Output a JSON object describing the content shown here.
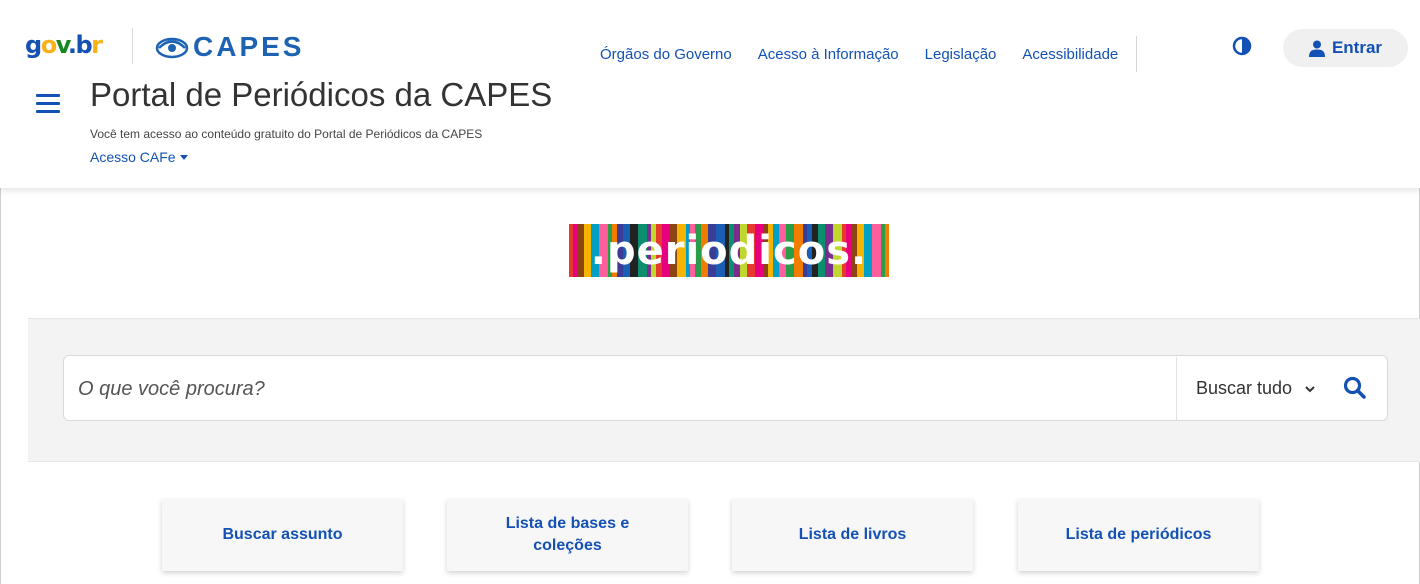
{
  "brand": {
    "govbr": "gov.br",
    "capes": "CAPES"
  },
  "nav": {
    "links": [
      "Órgãos do Governo",
      "Acesso à Informação",
      "Legislação",
      "Acessibilidade"
    ],
    "login_label": "Entrar"
  },
  "site": {
    "title": "Portal de Periódicos da CAPES",
    "subtitle": "Você tem acesso ao conteúdo gratuito do Portal de Periódicos da CAPES",
    "access_label": "Acesso CAFe"
  },
  "logo_text": ".periodicos.",
  "search": {
    "placeholder": "O que você procura?",
    "scope_selected": "Buscar tudo"
  },
  "quick_links": [
    "Buscar assunto",
    "Lista de bases e coleções",
    "Lista de livros",
    "Lista de periódicos"
  ],
  "colors": {
    "primary": "#1351b4",
    "capes_blue": "#1e62b3",
    "band_bg": "#f3f3f3"
  }
}
